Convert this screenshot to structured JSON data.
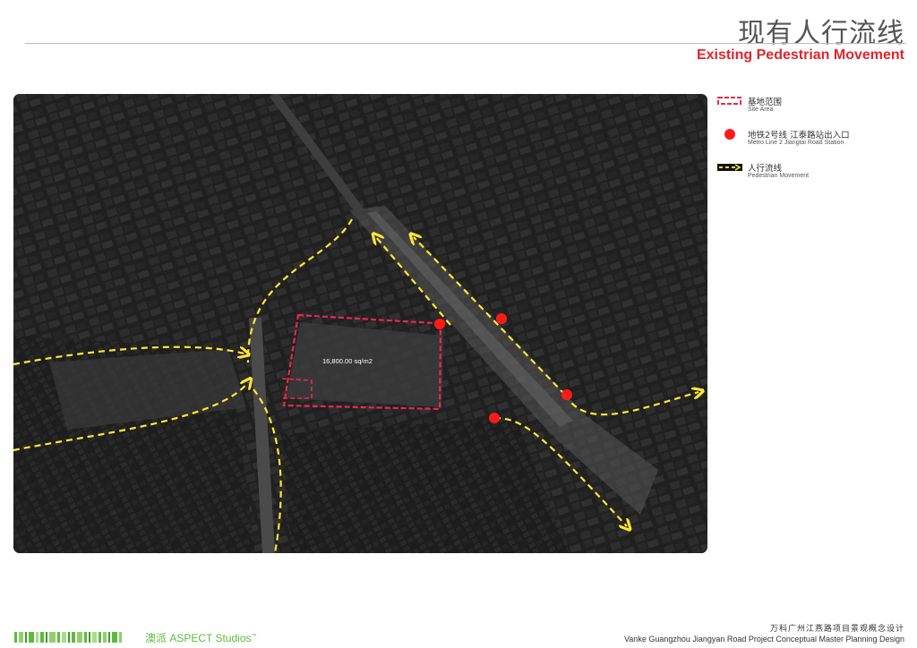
{
  "header": {
    "title_cn": "现有人行流线",
    "title_en": "Existing Pedestrian Movement"
  },
  "map": {
    "area_label": "16,800.00 sq/m2",
    "colors": {
      "site": "#e8284f",
      "station": "#ff1a1a",
      "path": "#ffe833"
    }
  },
  "legend": {
    "items": [
      {
        "icon": "site-area-swatch",
        "label_cn": "基地范围",
        "label_en": "Site Area"
      },
      {
        "icon": "metro-station-dot",
        "label_cn": "地铁2号线  江泰路站出入口",
        "label_en": "Metro Line 2   Jiangtai Road Station"
      },
      {
        "icon": "pedestrian-arrow",
        "label_cn": "人行流线",
        "label_en": "Pedestrian Movement"
      }
    ]
  },
  "footer": {
    "brand": "澳派 ASPECT Studios",
    "brand_mark": "™",
    "project_cn": "万科广州江燕路项目景观概念设计",
    "project_en": "Vanke Guangzhou Jiangyan Road Project Conceptual Master Planning Design"
  }
}
